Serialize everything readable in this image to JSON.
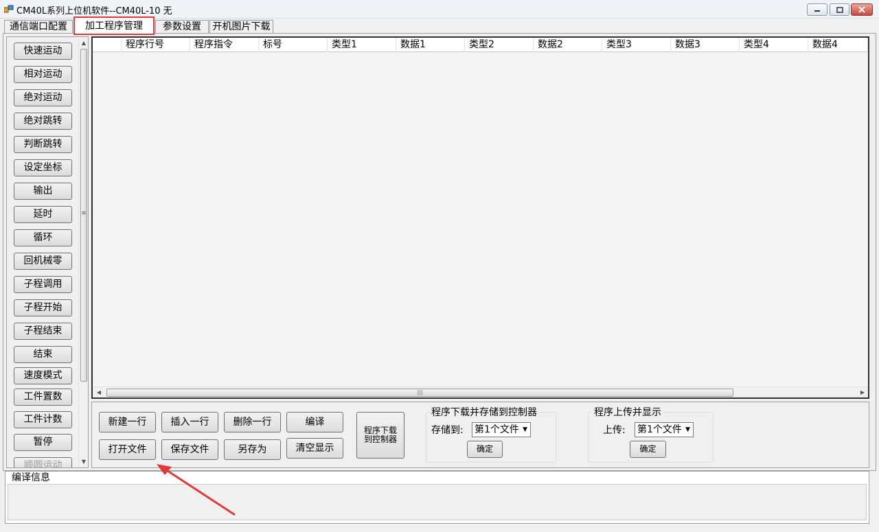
{
  "window": {
    "title": "CM40L系列上位机软件--CM40L-10    无"
  },
  "tabs": [
    "通信端口配置",
    "加工程序管理",
    "参数设置",
    "开机图片下载"
  ],
  "sidebar": {
    "commands": [
      "快速运动",
      "相对运动",
      "绝对运动",
      "绝对跳转",
      "判断跳转",
      "设定坐标",
      "输出",
      "延时",
      "循环",
      "回机械零",
      "子程调用",
      "子程开始",
      "子程结束",
      "结束",
      "速度模式",
      "工件置数",
      "工件计数",
      "暂停",
      "顺圆运动"
    ]
  },
  "grid": {
    "columns": [
      "程序行号",
      "程序指令",
      "标号",
      "类型1",
      "数据1",
      "类型2",
      "数据2",
      "类型3",
      "数据3",
      "类型4",
      "数据4"
    ]
  },
  "controls": {
    "new_row": "新建一行",
    "insert_row": "插入一行",
    "delete_row": "删除一行",
    "compile": "编译",
    "open_file": "打开文件",
    "save_file": "保存文件",
    "save_as": "另存为",
    "clear_display": "清空显示",
    "download": "程序下载\n到控制器",
    "download_group": {
      "title": "程序下载并存储到控制器",
      "label": "存储到:",
      "selected": "第1个文件",
      "confirm": "确定"
    },
    "upload_group": {
      "title": "程序上传并显示",
      "label": "上传:",
      "selected": "第1个文件",
      "confirm": "确定"
    }
  },
  "compile_info": {
    "label": "编译信息"
  },
  "colors": {
    "highlight": "#e03a3a",
    "annotation_arrow": "#e03a3a"
  }
}
